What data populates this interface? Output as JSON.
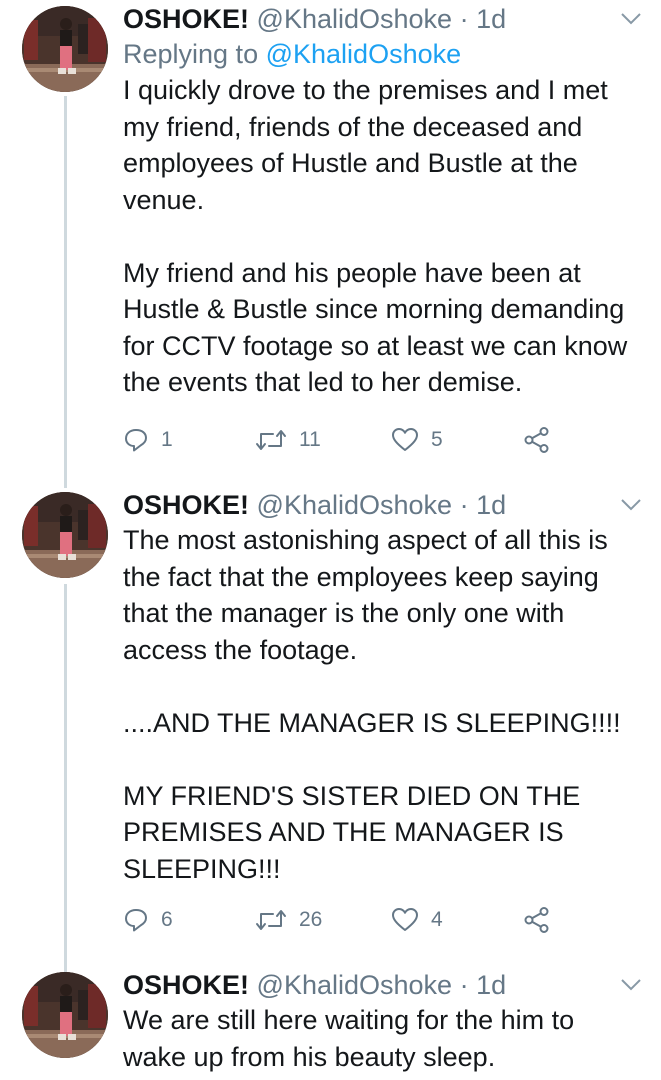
{
  "tweets": [
    {
      "name": "OSHOKE!",
      "handle": "@KhalidOshoke",
      "separator": "·",
      "time": "1d",
      "replying_label": "Replying to",
      "replying_handle": "@KhalidOshoke",
      "paragraphs": [
        "I quickly drove to the premises and I met my friend, friends of the deceased and employees of Hustle and Bustle at the venue.",
        "My friend and his people have been at Hustle & Bustle since morning demanding for CCTV footage so at least we can know the events that led to her demise."
      ],
      "replies": "1",
      "retweets": "11",
      "likes": "5"
    },
    {
      "name": "OSHOKE!",
      "handle": "@KhalidOshoke",
      "separator": "·",
      "time": "1d",
      "paragraphs": [
        "The most astonishing aspect of all this is the fact that the employees keep saying that the manager is the only one with access the footage.",
        "....AND THE MANAGER IS SLEEPING!!!!",
        "MY FRIEND'S SISTER DIED ON THE PREMISES AND THE MANAGER IS SLEEPING!!!"
      ],
      "replies": "6",
      "retweets": "26",
      "likes": "4"
    },
    {
      "name": "OSHOKE!",
      "handle": "@KhalidOshoke",
      "separator": "·",
      "time": "1d",
      "paragraphs": [
        "We are still here waiting for the him to wake up from his beauty sleep."
      ]
    }
  ],
  "icons": {
    "reply": "reply-icon",
    "retweet": "retweet-icon",
    "like": "heart-icon",
    "share": "share-icon",
    "menu": "chevron-down-icon"
  },
  "colors": {
    "text": "#14171a",
    "muted": "#657786",
    "link": "#1da1f2",
    "thread_line": "#cfd9de"
  }
}
